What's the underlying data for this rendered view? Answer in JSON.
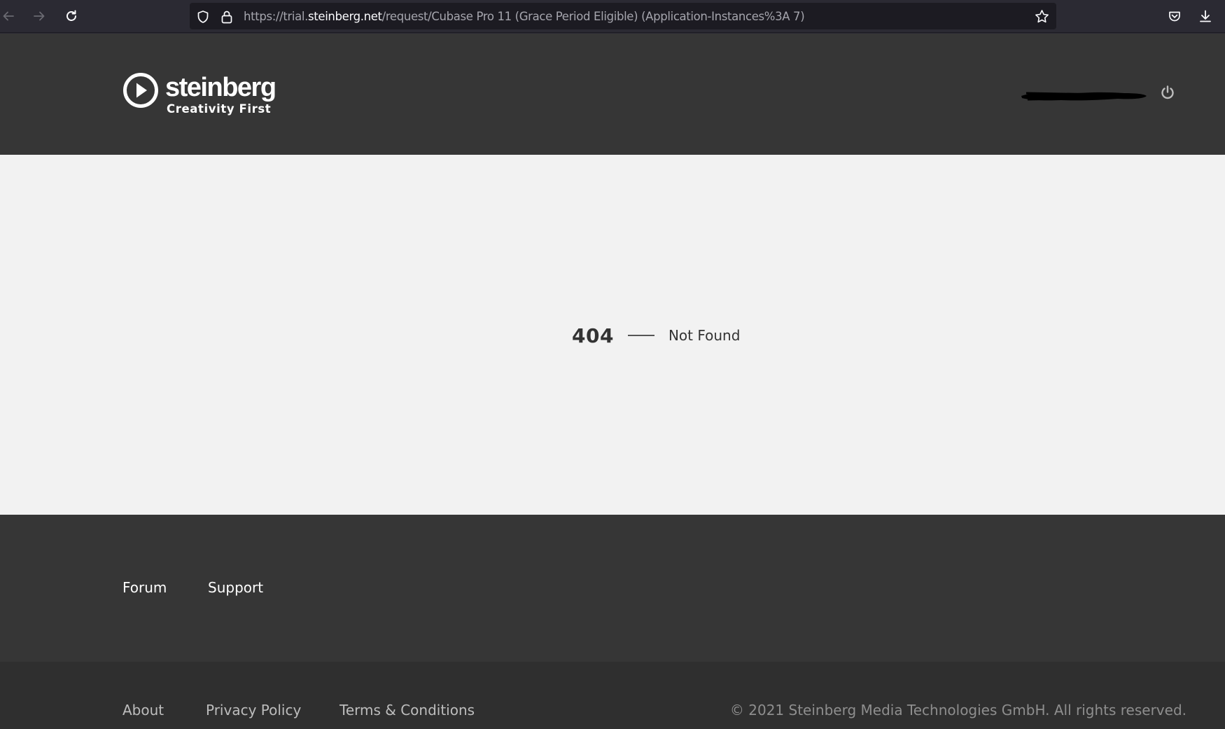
{
  "browser": {
    "url_prefix": "https://trial.",
    "url_host": "steinberg.net",
    "url_path": "/request/Cubase Pro 11 (Grace Period Eligible) (Application-Instances%3A 7)",
    "icons": [
      "back-icon",
      "forward-icon",
      "reload-icon",
      "shield-icon",
      "lock-icon",
      "star-icon",
      "pocket-icon",
      "download-icon"
    ]
  },
  "header": {
    "logo_word": "steinberg",
    "logo_tagline": "Creativity First",
    "user_name_redacted": true,
    "icons": [
      "play-circle-icon",
      "power-icon"
    ]
  },
  "main": {
    "error_code": "404",
    "error_message": "Not Found"
  },
  "footer": {
    "links": [
      "Forum",
      "Support"
    ],
    "legal_links": [
      "About",
      "Privacy Policy",
      "Terms & Conditions"
    ],
    "copyright": "© 2021 Steinberg Media Technologies GmbH. All rights reserved."
  },
  "colors": {
    "header_bg": "#363636",
    "main_bg": "#f2f2f2",
    "footer_bottom_bg": "#2f2f2f",
    "browser_bg": "#2b2a33"
  }
}
